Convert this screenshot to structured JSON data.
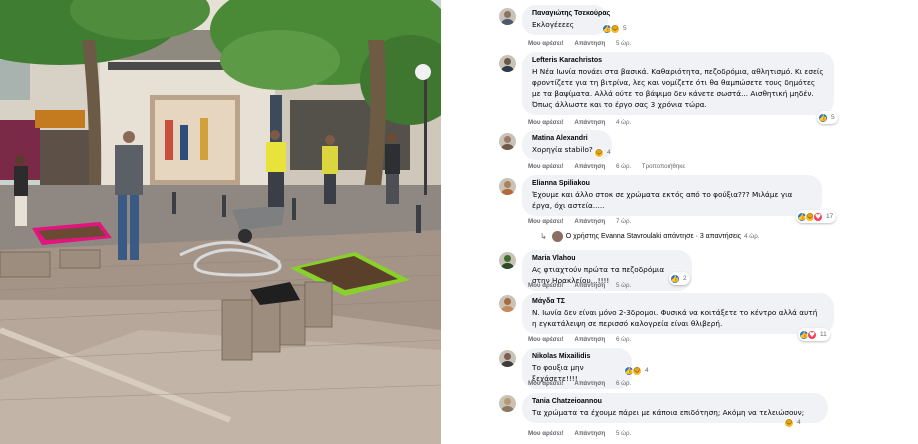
{
  "comments": [
    {
      "author": "Παναγιώτης Τσεκούρας",
      "text": "Εκλογέεεες",
      "actions": {
        "like": "Μου αρέσει!",
        "reply": "Απάντηση",
        "time": "5 ώρ."
      },
      "reactions": {
        "count": "5",
        "icons": [
          "like-icon",
          "haha-icon"
        ]
      }
    },
    {
      "author": "Lefteris Karachristos",
      "text": "Η Νέα Ιωνία πονάει στα βασικά. Καθαριότητα, πεζοδρόμια, αθλητισμό. Κι εσείς φροντίζετε για τη βιτρίνα, λες και νομίζετε ότι θα θαμπώσετε τους δημότες με τα βαψίματα. Αλλά ούτε το βάψιμο δεν κάνετε σωστά... Αισθητική μηδέν. Όπως άλλωστε και το έργο σας 3 χρόνια τώρα.",
      "actions": {
        "like": "Μου αρέσει!",
        "reply": "Απάντηση",
        "time": "4 ώρ."
      },
      "reactions": {
        "count": "5",
        "icons": [
          "like-icon"
        ]
      }
    },
    {
      "author": "Matina Alexandri",
      "text": "Χορηγία stabilo?",
      "actions": {
        "like": "Μου αρέσει!",
        "reply": "Απάντηση",
        "time": "6 ώρ.",
        "edited": "Τροποποιήθηκε"
      },
      "reactions": {
        "count": "4",
        "icons": [
          "haha-icon"
        ]
      }
    },
    {
      "author": "Elianna Spiliakou",
      "text": "Έχουμε και άλλο στοκ σε χρώματα εκτός από το φούξια??? Μιλάμε για έργα, όχι αστεία.....",
      "actions": {
        "like": "Μου αρέσει!",
        "reply": "Απάντηση",
        "time": "7 ώρ."
      },
      "reactions": {
        "count": "17",
        "icons": [
          "like-icon",
          "haha-icon",
          "love-icon"
        ]
      },
      "replies": {
        "text": "Ο χρήστης Evanna Stavroulaki απάντησε · 3 απαντήσεις",
        "time": "4 ώρ."
      }
    },
    {
      "author": "Maria Vlahou",
      "text": "Ας φτιαχτούν πρώτα τα πεζοδρόμια στην Ηρακλείου...!!!!",
      "actions": {
        "like": "Μου αρέσει!",
        "reply": "Απάντηση",
        "time": "5 ώρ."
      },
      "reactions": {
        "count": "2",
        "icons": [
          "like-icon"
        ]
      }
    },
    {
      "author": "Μάγδα ΤΣ",
      "text": "Ν. Ιωνία δεν είναι μόνο 2-3δρομοι. Φυσικά να κοιτάξετε το κέντρο αλλά αυτή η εγκατάλειψη σε περισσό καλογρεία είναι θλιβερή.",
      "actions": {
        "like": "Μου αρέσει!",
        "reply": "Απάντηση",
        "time": "6 ώρ."
      },
      "reactions": {
        "count": "11",
        "icons": [
          "like-icon",
          "love-icon"
        ]
      }
    },
    {
      "author": "Nikolas Mixailidis",
      "text": "Το φουξια μην ξεχάσετε!!!!",
      "actions": {
        "like": "Μου αρέσει!",
        "reply": "Απάντηση",
        "time": "6 ώρ."
      },
      "reactions": {
        "count": "4",
        "icons": [
          "like-icon",
          "haha-icon"
        ]
      }
    },
    {
      "author": "Tania Chatzeioannou",
      "text": "Τα χρώματα τα έχουμε πάρει με κάποια επιδότηση; Ακόμη να τελειώσουν;",
      "actions": {
        "like": "Μου αρέσει!",
        "reply": "Απάντηση",
        "time": "5 ώρ."
      },
      "reactions": {
        "count": "4",
        "icons": [
          "haha-icon"
        ]
      }
    }
  ]
}
